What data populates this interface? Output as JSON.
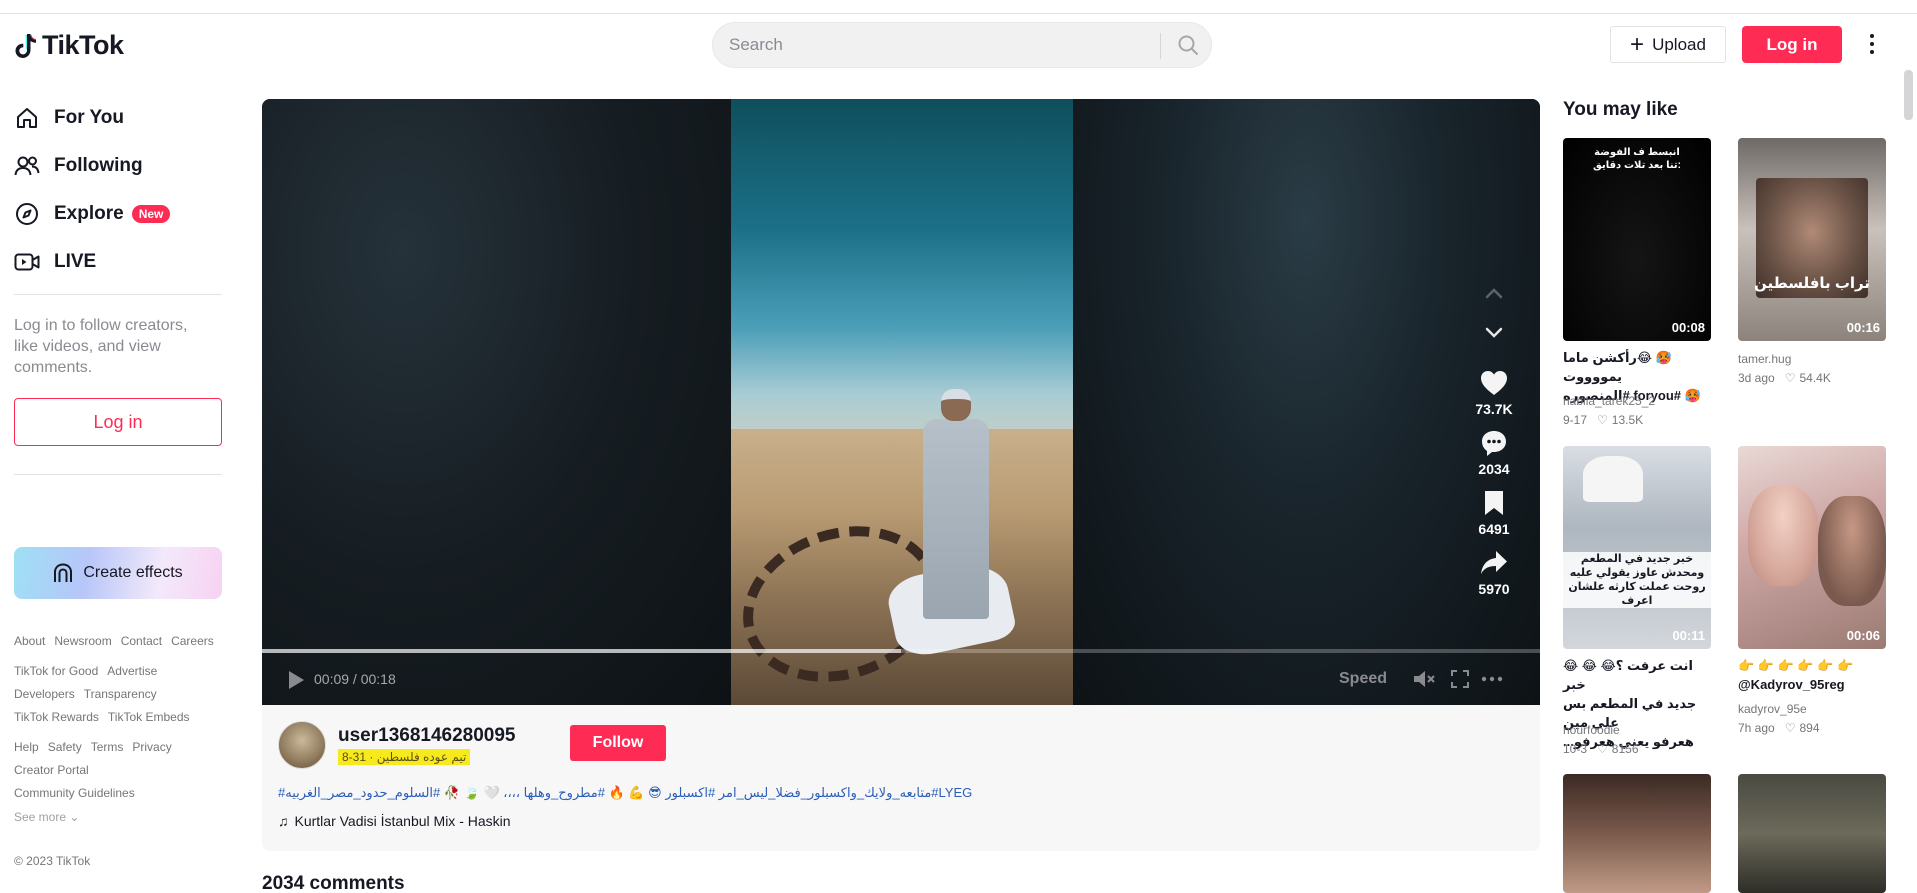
{
  "header": {
    "logo_text": "TikTok",
    "search_placeholder": "Search",
    "upload_label": "Upload",
    "login_label": "Log in"
  },
  "sidebar": {
    "nav": [
      {
        "label": "For You",
        "icon": "home-icon"
      },
      {
        "label": "Following",
        "icon": "following-icon"
      },
      {
        "label": "Explore",
        "icon": "compass-icon",
        "badge": "New"
      },
      {
        "label": "LIVE",
        "icon": "live-icon"
      }
    ],
    "login_hint": "Log in to follow creators, like videos, and view comments.",
    "login_button": "Log in",
    "create_effects": "Create effects",
    "footer_rows": [
      [
        "About",
        "Newsroom",
        "Contact",
        "Careers"
      ],
      [
        "TikTok for Good",
        "Advertise"
      ],
      [
        "Developers",
        "Transparency"
      ],
      [
        "TikTok Rewards",
        "TikTok Embeds"
      ],
      [
        "Help",
        "Safety",
        "Terms",
        "Privacy"
      ],
      [
        "Creator Portal"
      ],
      [
        "Community Guidelines"
      ]
    ],
    "see_more": "See more",
    "copyright": "© 2023 TikTok"
  },
  "video": {
    "like_count": "73.7K",
    "comment_count": "2034",
    "save_count": "6491",
    "share_count": "5970",
    "time": "00:09 / 00:18",
    "progress": 0.5,
    "speed_label": "Speed",
    "author": "user1368146280095",
    "author_sub": "8-31 · تيم عوده فلسطين",
    "follow_label": "Follow",
    "caption": "#متابعه_ولايك_واكسبلور_فضلا_ليس_امر #اكسبلور 😎 💪 🔥 #مطروح_وهلها ،،،، 🤍 🍃 🥀 #السلوم_حدود_مصر_الغربيه#LYEG",
    "music": "Kurtlar Vadisi İstanbul Mix - Haskin"
  },
  "comments_title": "2034 comments",
  "suggestions": {
    "title": "You may like",
    "items": [
      {
        "duration": "00:08",
        "overlay": "انبسط ف الفوضة\nتنا بعد تلات دقايق:",
        "caption": "🥵 😂رأكشن ماما يمووووت\n🥵 #foryou #المنصوره",
        "user": "nabila_tarek25_2",
        "date": "9-17",
        "likes": "13.5K"
      },
      {
        "duration": "00:16",
        "overlay": "تراب بافلسطين",
        "caption": "",
        "user": "tamer.hug",
        "date": "3d ago",
        "likes": "54.4K"
      },
      {
        "duration": "00:11",
        "overlay": "خبر جديد في المطعم\nومحدش عاوز يقولي عليه\nروحت عملت كارثه علشان اعرف",
        "caption": "انت عرفت ؟😂 😂 😂 خبر\nجديد في المطعم بس علي مين\nهعرفو يعني هعرفو...",
        "user": "nourfoodie",
        "date": "10-3",
        "likes": "8156"
      },
      {
        "duration": "00:06",
        "overlay": "",
        "caption": "👉 👉 👉 👉 👉 👉\n@Kadyrov_95reg",
        "user": "kadyrov_95e",
        "date": "7h ago",
        "likes": "894"
      }
    ]
  }
}
